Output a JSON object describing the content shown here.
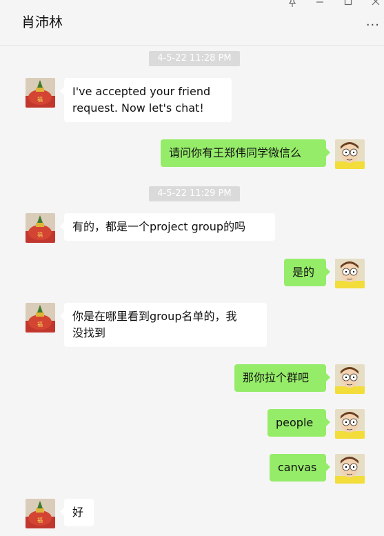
{
  "header": {
    "title": "肖沛林",
    "pin_icon": "pin-icon",
    "minimize_icon": "minimize-icon",
    "maximize_icon": "maximize-icon",
    "close_icon": "close-icon",
    "more_icon": "more-icon"
  },
  "timestamps": [
    "4-5-22 11:28 PM",
    "4-5-22 11:29 PM"
  ],
  "messages": [
    {
      "side": "in",
      "text": "I've accepted your friend\nrequest. Now let's chat!"
    },
    {
      "side": "out",
      "text": "请问你有王郑伟同学微信么"
    },
    {
      "side": "in",
      "text": "有的，都是一个project group的吗"
    },
    {
      "side": "out",
      "text": "是的"
    },
    {
      "side": "in",
      "text": "你是在哪里看到group名单的，我\n没找到"
    },
    {
      "side": "out",
      "text": "那你拉个群吧"
    },
    {
      "side": "out",
      "text": "people"
    },
    {
      "side": "out",
      "text": "canvas"
    },
    {
      "side": "in",
      "text": "好"
    }
  ],
  "colors": {
    "background": "#f5f5f5",
    "incoming_bubble": "#ffffff",
    "outgoing_bubble": "#95ec69",
    "timestamp_bg": "#dadada"
  }
}
